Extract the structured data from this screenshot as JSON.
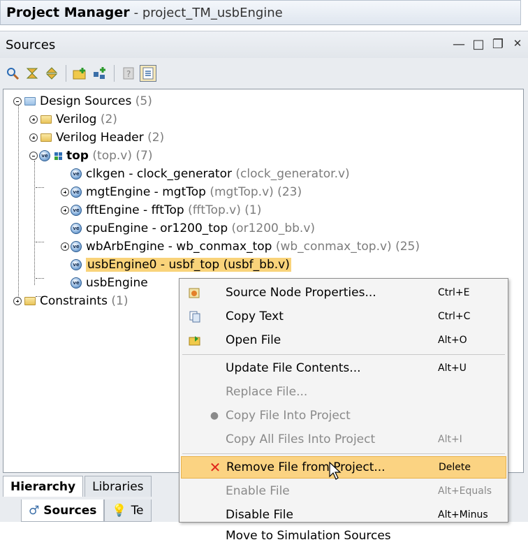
{
  "title": {
    "bold": "Project Manager",
    "rest": "- project_TM_usbEngine"
  },
  "panel": {
    "title": "Sources",
    "controls": [
      "minimize",
      "maximize",
      "restore",
      "close"
    ]
  },
  "toolbar": {
    "icons": [
      "search-icon",
      "collapse-all-icon",
      "expand-all-icon",
      "add-sources-icon",
      "add-hierarchy-icon",
      "properties-icon",
      "show-source-icon"
    ]
  },
  "tree": {
    "design_sources": {
      "label": "Design Sources",
      "count": "(5)"
    },
    "verilog": {
      "label": "Verilog",
      "count": "(2)"
    },
    "verilog_header": {
      "label": "Verilog Header",
      "count": "(2)"
    },
    "top": {
      "label": "top",
      "extra": "(top.v) (7)"
    },
    "clkgen": {
      "label": "clkgen - clock_generator",
      "extra": "(clock_generator.v)"
    },
    "mgt": {
      "label": "mgtEngine - mgtTop",
      "extra": "(mgtTop.v) (23)"
    },
    "fft": {
      "label": "fftEngine - fftTop",
      "extra": "(fftTop.v) (1)"
    },
    "cpu": {
      "label": "cpuEngine - or1200_top",
      "extra": "(or1200_bb.v)"
    },
    "wbarb": {
      "label": "wbArbEngine - wb_conmax_top",
      "extra": "(wb_conmax_top.v) (25)"
    },
    "usb0": {
      "label": "usbEngine0 - usbf_top (usbf_bb.v)"
    },
    "usb1": {
      "label": "usbEngine"
    },
    "constraints": {
      "label": "Constraints",
      "count": "(1)"
    }
  },
  "tabs": {
    "hierarchy": "Hierarchy",
    "libraries": "Libraries",
    "sources": "Sources",
    "templates": "Te"
  },
  "menu": [
    {
      "label": "Source Node Properties...",
      "shortcut": "Ctrl+E"
    },
    {
      "label": "Copy Text",
      "shortcut": "Ctrl+C"
    },
    {
      "label": "Open File",
      "shortcut": "Alt+O"
    },
    {
      "label": "Update File Contents...",
      "shortcut": "Alt+U"
    },
    {
      "label": "Replace File...",
      "shortcut": ""
    },
    {
      "label": "Copy File Into Project",
      "shortcut": ""
    },
    {
      "label": "Copy All Files Into Project",
      "shortcut": "Alt+I"
    },
    {
      "label": "Remove File from Project...",
      "shortcut": "Delete"
    },
    {
      "label": "Enable File",
      "shortcut": "Alt+Equals"
    },
    {
      "label": "Disable File",
      "shortcut": "Alt+Minus"
    },
    {
      "label": "Move to Simulation Sources",
      "shortcut": ""
    }
  ],
  "colors": {
    "selection": "#f9d37a",
    "menu_highlight": "#fbd382",
    "remove_x": "#e0261b"
  }
}
